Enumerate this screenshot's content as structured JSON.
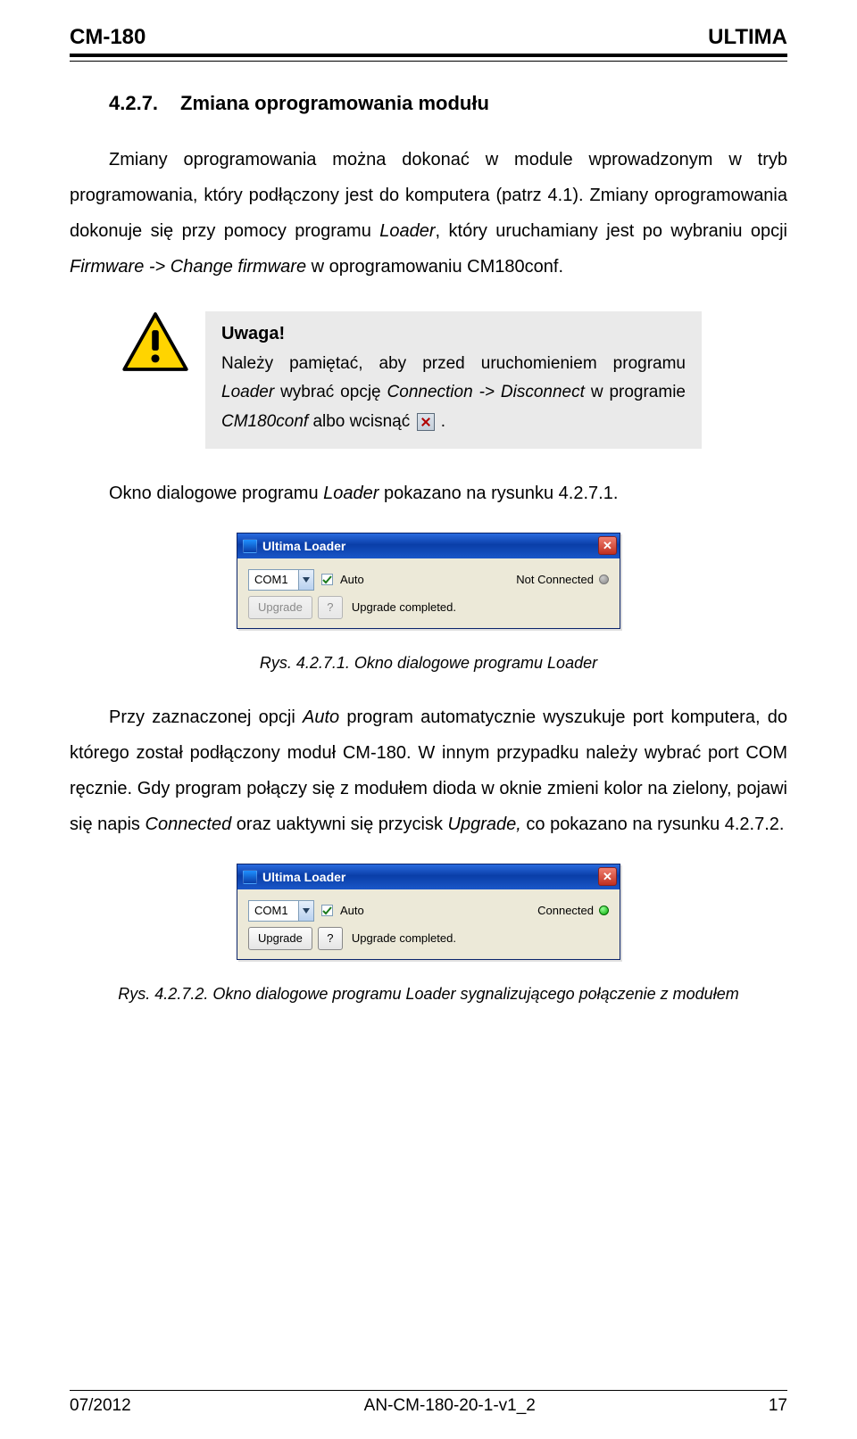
{
  "header": {
    "left": "CM-180",
    "right": "ULTIMA"
  },
  "section": {
    "number": "4.2.7.",
    "title": "Zmiana oprogramowania modułu"
  },
  "para1_parts": {
    "a": "Zmiany oprogramowania można dokonać w module wprowadzonym w tryb programowania, który podłączony jest do komputera (patrz 4.1). Zmiany oprogramowania dokonuje się przy pomocy programu ",
    "loader": "Loader",
    "b": ", który uruchamiany jest po wybraniu opcji ",
    "path": "Firmware -> Change firmware",
    "c": " w oprogramowaniu CM180conf."
  },
  "note": {
    "title": "Uwaga!",
    "a": "Należy pamiętać, aby przed uruchomieniem programu ",
    "loader": "Loader",
    "b": " wybrać opcję ",
    "path": "Connection -> Disconnect",
    "c": " w programie ",
    "prog": "CM180conf",
    "d": " albo wcisnąć",
    "e": "."
  },
  "para2": {
    "a": "Okno dialogowe programu ",
    "loader": "Loader",
    "b": " pokazano na rysunku 4.2.7.1."
  },
  "caption1": "Rys. 4.2.7.1. Okno dialogowe programu Loader",
  "para3": {
    "a": "Przy zaznaczonej opcji ",
    "auto": "Auto",
    "b": " program automatycznie wyszukuje port komputera, do którego został podłączony moduł CM-180. W innym przypadku należy wybrać port COM ręcznie. Gdy program połączy się z modułem dioda w oknie zmieni kolor na zielony, pojawi się napis ",
    "connected": "Connected",
    "c": " oraz uaktywni się przycisk ",
    "upgrade": "Upgrade,",
    "d": " co pokazano na rysunku 4.2.7.2."
  },
  "caption2": "Rys. 4.2.7.2. Okno dialogowe programu Loader sygnalizującego połączenie z modułem",
  "dialog": {
    "title": "Ultima Loader",
    "port": "COM1",
    "auto_label": "Auto",
    "status_not": "Not Connected",
    "status_ok": "Connected",
    "upgrade": "Upgrade",
    "q": "?",
    "completed": "Upgrade completed."
  },
  "footer": {
    "left": "07/2012",
    "center": "AN-CM-180-20-1-v1_2",
    "right": "17"
  }
}
